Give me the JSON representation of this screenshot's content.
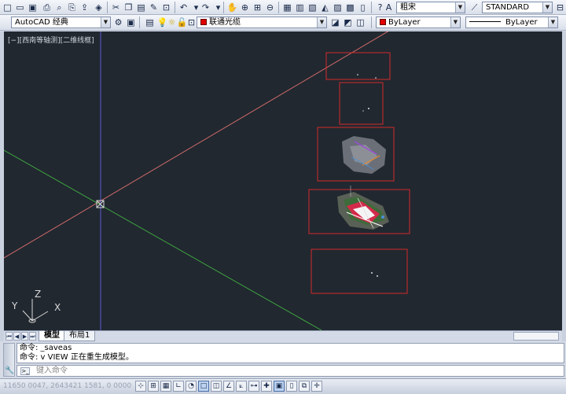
{
  "toolbar_top": {
    "font_combo": "粗宋",
    "textstyle_combo": "STANDARD"
  },
  "toolbar_second": {
    "workspace_combo": "AutoCAD 经典",
    "layer_combo": "联通光缆",
    "color_combo": "ByLayer",
    "linetype_combo": "ByLayer"
  },
  "viewport": {
    "label": "[−][西南等轴测][二维线框]",
    "ucs_x": "X",
    "ucs_y": "Y",
    "ucs_z": "Z"
  },
  "tabs": {
    "model": "模型",
    "layout1": "布局1"
  },
  "command": {
    "line1": "命令: _saveas",
    "line2": "命令: v VIEW 正在重生成模型。",
    "placeholder": "键入命令"
  },
  "status": {
    "coords": "11650 0047, 2643421 1581, 0 0000"
  },
  "colors": {
    "canvas": "#212830",
    "red_axis": "#d06a6a",
    "green_axis": "#3fa43f",
    "blue_axis": "#5a5ad0",
    "frame": "#d22a2a",
    "layer_swatch": "#e00000"
  }
}
